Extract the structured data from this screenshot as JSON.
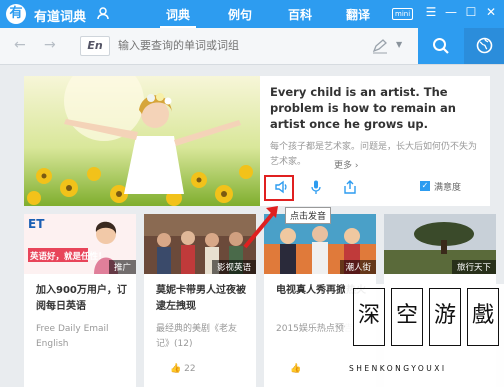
{
  "app": {
    "logo_letter": "有",
    "name": "有道词典",
    "mini_label": "mini"
  },
  "nav": {
    "tabs": [
      {
        "label": "词典",
        "active": true
      },
      {
        "label": "例句",
        "active": false
      },
      {
        "label": "百科",
        "active": false
      },
      {
        "label": "翻译",
        "active": false
      }
    ]
  },
  "search": {
    "lang": "En",
    "placeholder": "输入要查询的单词或词组"
  },
  "daily": {
    "quote_en": "Every child is an artist. The problem is how to remain an artist once he grows up.",
    "quote_cn": "每个孩子都是艺术家。问题是，长大后如何仍不失为艺术家。",
    "more_label": "更多",
    "tooltip": "点击发音",
    "satisfaction_label": "满意度"
  },
  "cards": [
    {
      "tag": "推广",
      "banner_text": "英语好，就是任性！",
      "title": "加入900万用户，订阅每日英语",
      "desc": "Free Daily Email English",
      "likes": ""
    },
    {
      "tag": "影视英语",
      "banner_text": "",
      "title": "莫妮卡带男人过夜被逮左拽现",
      "desc": "最经典的美剧《老友记》(12)",
      "likes": "22"
    },
    {
      "tag": "潮人街",
      "banner_text": "",
      "title": "电视真人秀再掀热火",
      "desc": "2015娱乐热点预告",
      "likes": ""
    },
    {
      "tag": "旅行天下",
      "banner_text": "",
      "title": "",
      "desc": "",
      "likes": ""
    }
  ],
  "watermark": {
    "chars": [
      "深",
      "空",
      "游",
      "戲"
    ],
    "sub": "SHENKONGYOUXI"
  },
  "colors": {
    "accent": "#2d9cf0",
    "highlight": "#e02020"
  }
}
